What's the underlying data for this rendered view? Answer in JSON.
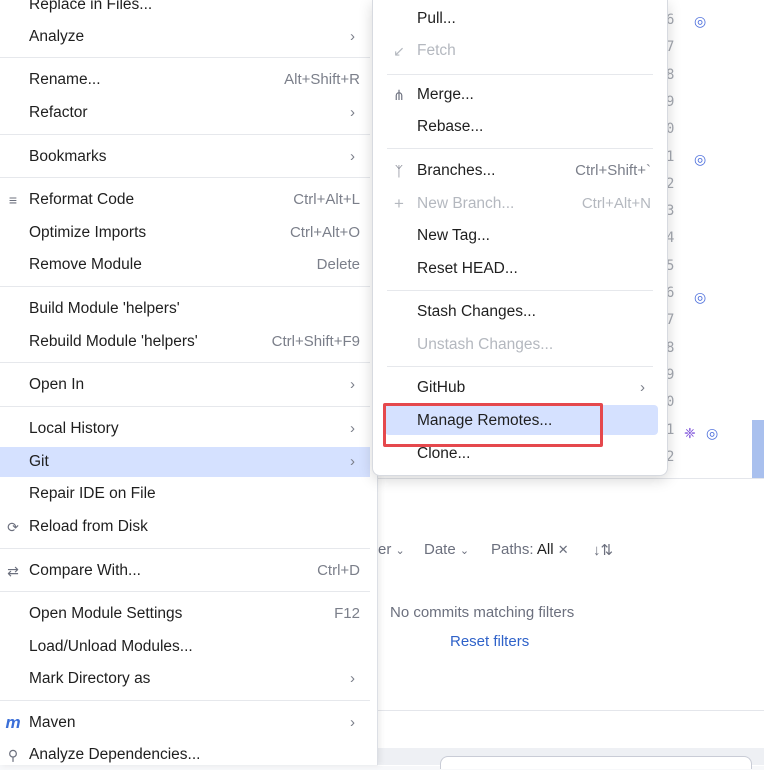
{
  "left_menu": {
    "items": [
      {
        "label": "Replace in Files...",
        "shortcut": "",
        "submenu": false
      },
      {
        "label": "Analyze",
        "shortcut": "",
        "submenu": true
      },
      {
        "label": "Rename...",
        "shortcut": "Alt+Shift+R",
        "submenu": false
      },
      {
        "label": "Refactor",
        "shortcut": "",
        "submenu": true
      },
      {
        "label": "Bookmarks",
        "shortcut": "",
        "submenu": true
      },
      {
        "label": "Reformat Code",
        "shortcut": "Ctrl+Alt+L",
        "submenu": false,
        "icon": "reformat-icon"
      },
      {
        "label": "Optimize Imports",
        "shortcut": "Ctrl+Alt+O",
        "submenu": false
      },
      {
        "label": "Remove Module",
        "shortcut": "Delete",
        "submenu": false
      },
      {
        "label": "Build Module 'helpers'",
        "shortcut": "",
        "submenu": false
      },
      {
        "label": "Rebuild Module 'helpers'",
        "shortcut": "Ctrl+Shift+F9",
        "submenu": false
      },
      {
        "label": "Open In",
        "shortcut": "",
        "submenu": true
      },
      {
        "label": "Local History",
        "shortcut": "",
        "submenu": true
      },
      {
        "label": "Git",
        "shortcut": "",
        "submenu": true,
        "selected": true
      },
      {
        "label": "Repair IDE on File",
        "shortcut": "",
        "submenu": false
      },
      {
        "label": "Reload from Disk",
        "shortcut": "",
        "submenu": false,
        "icon": "reload-icon"
      },
      {
        "label": "Compare With...",
        "shortcut": "Ctrl+D",
        "submenu": false,
        "icon": "compare-icon"
      },
      {
        "label": "Open Module Settings",
        "shortcut": "F12",
        "submenu": false
      },
      {
        "label": "Load/Unload Modules...",
        "shortcut": "",
        "submenu": false
      },
      {
        "label": "Mark Directory as",
        "shortcut": "",
        "submenu": true
      },
      {
        "label": "Maven",
        "shortcut": "",
        "submenu": true,
        "icon": "maven-icon"
      },
      {
        "label": "Analyze Dependencies...",
        "shortcut": "",
        "submenu": false
      }
    ]
  },
  "git_menu": {
    "items": [
      {
        "label": "Pull...",
        "shortcut": "",
        "disabled": false
      },
      {
        "label": "Fetch",
        "shortcut": "",
        "disabled": true,
        "icon": "fetch-icon"
      },
      {
        "label": "Merge...",
        "shortcut": "",
        "disabled": false,
        "icon": "merge-icon"
      },
      {
        "label": "Rebase...",
        "shortcut": "",
        "disabled": false
      },
      {
        "label": "Branches...",
        "shortcut": "Ctrl+Shift+`",
        "disabled": false,
        "icon": "branch-icon"
      },
      {
        "label": "New Branch...",
        "shortcut": "Ctrl+Alt+N",
        "disabled": true,
        "icon": "plus-icon"
      },
      {
        "label": "New Tag...",
        "shortcut": "",
        "disabled": false
      },
      {
        "label": "Reset HEAD...",
        "shortcut": "",
        "disabled": false
      },
      {
        "label": "Stash Changes...",
        "shortcut": "",
        "disabled": false
      },
      {
        "label": "Unstash Changes...",
        "shortcut": "",
        "disabled": true
      },
      {
        "label": "GitHub",
        "shortcut": "",
        "disabled": false,
        "submenu": true
      },
      {
        "label": "Manage Remotes...",
        "shortcut": "",
        "disabled": false,
        "highlighted": true
      },
      {
        "label": "Clone...",
        "shortcut": "",
        "disabled": false
      }
    ]
  },
  "gutter": {
    "line_numbers": [
      "6",
      "7",
      "8",
      "9",
      "0",
      "1",
      "2",
      "3",
      "4",
      "5",
      "6",
      "7",
      "8",
      "9",
      "0",
      "1",
      "2"
    ]
  },
  "log_panel": {
    "filter_user": "er",
    "filter_date": "Date",
    "filter_paths_label": "Paths:",
    "filter_paths_value": "All",
    "empty_message": "No commits matching filters",
    "reset_link": "Reset filters"
  },
  "colors": {
    "selection": "#d5e1ff",
    "highlight_box": "#e5484d",
    "link": "#2f62c9"
  }
}
